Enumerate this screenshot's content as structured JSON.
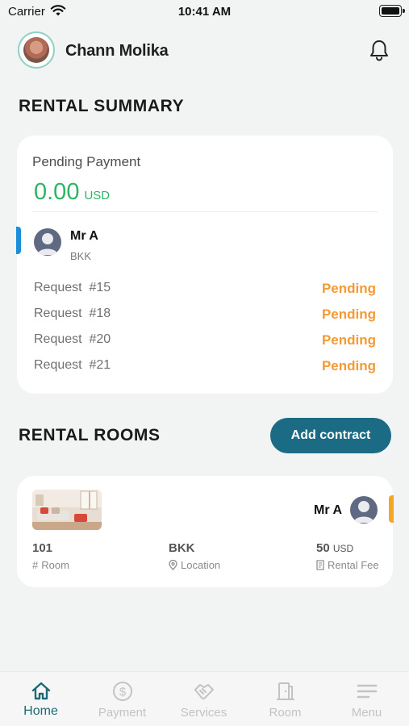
{
  "status_bar": {
    "carrier": "Carrier",
    "time": "10:41 AM"
  },
  "header": {
    "user_name": "Chann Molika"
  },
  "rental_summary": {
    "title": "RENTAL SUMMARY",
    "pending_label": "Pending Payment",
    "amount": "0.00",
    "currency": "USD",
    "tenant": {
      "name": "Mr A",
      "location": "BKK"
    },
    "requests": [
      {
        "label": "Request  #15",
        "status": "Pending"
      },
      {
        "label": "Request  #18",
        "status": "Pending"
      },
      {
        "label": "Request  #20",
        "status": "Pending"
      },
      {
        "label": "Request  #21",
        "status": "Pending"
      }
    ]
  },
  "rental_rooms": {
    "title": "RENTAL ROOMS",
    "add_button": "Add contract",
    "room": {
      "tenant_name": "Mr A",
      "room_number": "101",
      "room_caption": "Room",
      "location": "BKK",
      "location_caption": "Location",
      "fee": "50",
      "fee_currency": "USD",
      "fee_caption": "Rental Fee"
    }
  },
  "tabs": [
    {
      "label": "Home",
      "icon": "home-icon",
      "active": true
    },
    {
      "label": "Payment",
      "icon": "dollar-icon",
      "active": false
    },
    {
      "label": "Services",
      "icon": "handshake-icon",
      "active": false
    },
    {
      "label": "Room",
      "icon": "door-icon",
      "active": false
    },
    {
      "label": "Menu",
      "icon": "menu-icon",
      "active": false
    }
  ],
  "colors": {
    "accent_green": "#2db467",
    "pending_orange": "#f59a33",
    "primary_button": "#1c6b85",
    "tab_active": "#1d6a77",
    "accent_blue": "#1b8fd8",
    "accent_orange": "#f5a623"
  }
}
